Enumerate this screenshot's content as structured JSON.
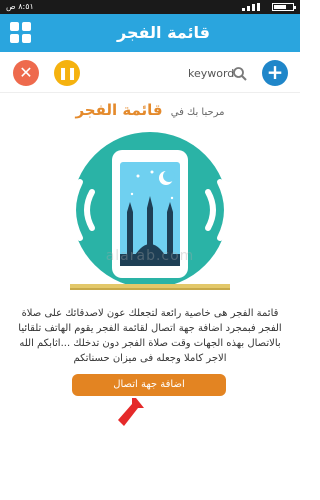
{
  "status": {
    "time": "٨:٥١ ص"
  },
  "appbar": {
    "title": "قائمة الفجر"
  },
  "toolbar": {
    "search_placeholder": "keyword"
  },
  "welcome": {
    "text": "مرحبا بك في",
    "brand": "قائمة الفجر"
  },
  "description": "قائمة الفجر هى خاصية رائعة لتجعلك عون لاصدقائك على صلاة الفجر فبمجرد اضافة جهة اتصال لقائمة الفجر يقوم الهاتف تلقائيا بالاتصال بهذه الجهات وقت صلاة الفجر دون تدخلك ...اثابكم الله الاجر كاملا وجعله فى ميزان حسناتكم",
  "cta": {
    "label": "اضافة جهة اتصال"
  },
  "watermark": "alarab.com",
  "colors": {
    "appbar": "#2aa5de",
    "close": "#ee6a4d",
    "pause": "#f5b20f",
    "add": "#1f86c9",
    "accent": "#e48a2c",
    "circle": "#2ab3a6"
  }
}
